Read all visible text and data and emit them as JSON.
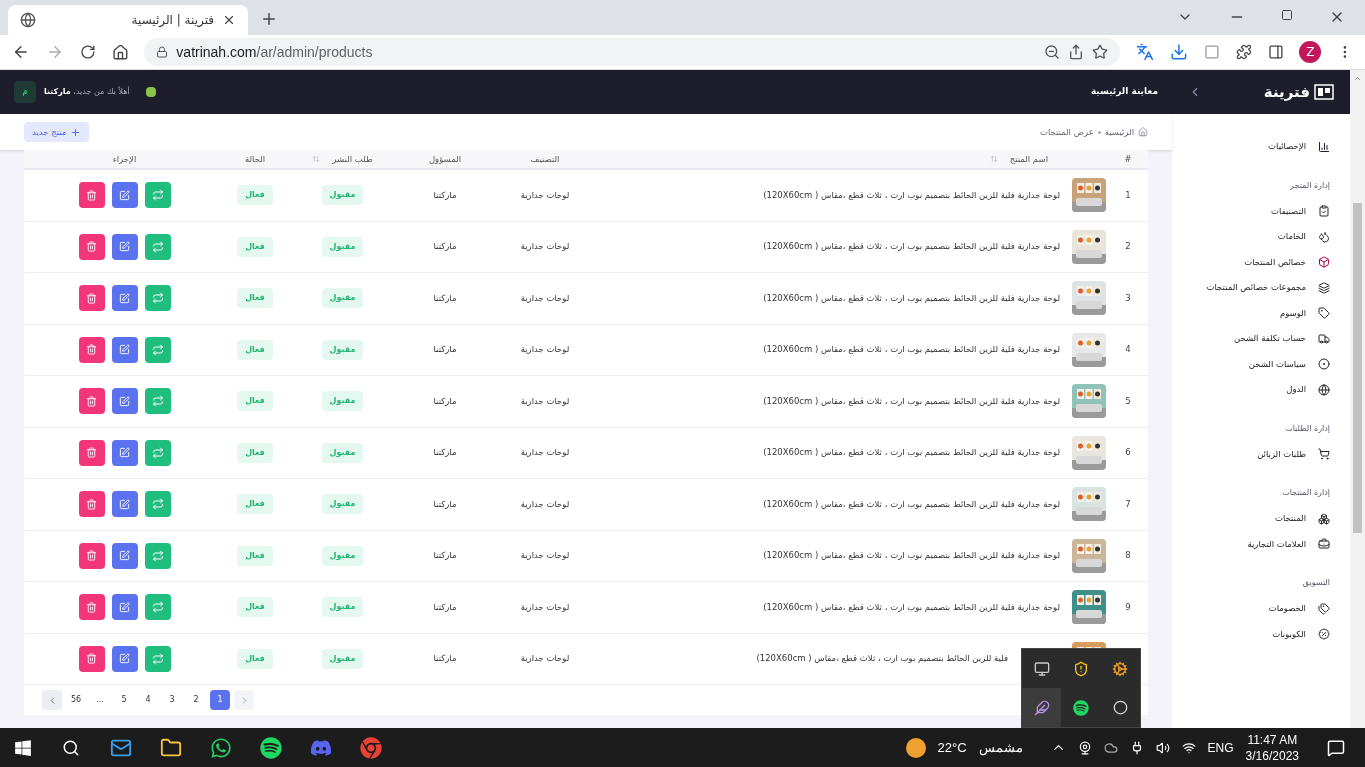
{
  "browser": {
    "tab_title": "فترينة | الرئيسية",
    "url_host": "vatrinah.com",
    "url_path": "/ar/admin/products",
    "profile": "Z"
  },
  "header": {
    "brand": "فترينة",
    "preview_link": "معاينة الرئيسية",
    "welcome": "أهلاً بك من جديد،",
    "user": "ماركتنا",
    "avatar": "م"
  },
  "sidebar": {
    "items": [
      {
        "kind": "item",
        "label": "الإحصائيات"
      },
      {
        "kind": "section",
        "label": "إدارة المتجر"
      },
      {
        "kind": "item",
        "label": "التصنيفات"
      },
      {
        "kind": "item",
        "label": "الخامات"
      },
      {
        "kind": "item",
        "label": "خصائص المنتجات"
      },
      {
        "kind": "item",
        "label": "مجموعات خصائص المنتجات"
      },
      {
        "kind": "item",
        "label": "الوسوم"
      },
      {
        "kind": "item",
        "label": "حساب تكلفة الشحن"
      },
      {
        "kind": "item",
        "label": "سياسات الشحن"
      },
      {
        "kind": "item",
        "label": "الدول"
      },
      {
        "kind": "section",
        "label": "إدارة الطلبات"
      },
      {
        "kind": "item",
        "label": "طلبات الزبائن"
      },
      {
        "kind": "section",
        "label": "إدارة المنتجات"
      },
      {
        "kind": "item",
        "label": "المنتجات"
      },
      {
        "kind": "item",
        "label": "العلامات التجارية"
      },
      {
        "kind": "section",
        "label": "التسويق"
      },
      {
        "kind": "item",
        "label": "الخصومات"
      },
      {
        "kind": "item",
        "label": "الكوبونات"
      }
    ]
  },
  "breadcrumb": [
    "الرئيسية",
    "عرض المنتجات"
  ],
  "new_button": "منتج جديد",
  "table": {
    "columns": [
      "#",
      "اسم المنتج",
      "التصنيف",
      "المسؤول",
      "طلب النشر",
      "الحالة",
      "الإجراء"
    ],
    "rows": [
      {
        "index": "1",
        "name": "لوحة جدارية فلية للزين الحائط بتصميم بوب ارت ، ثلاث قطع ،مقاس ( 120X60cm)",
        "category": "لوحات جدارية",
        "owner": "ماركتنا",
        "publish": "مقبول",
        "status": "فعال"
      },
      {
        "index": "2",
        "name": "لوحة جدارية فلية للزين الحائط بتصميم بوب ارت ، ثلاث قطع ،مقاس ( 120X60cm)",
        "category": "لوحات جدارية",
        "owner": "ماركتنا",
        "publish": "مقبول",
        "status": "فعال"
      },
      {
        "index": "3",
        "name": "لوحة جدارية فلية للزين الحائط بتصميم بوب ارت ، ثلاث قطع ،مقاس ( 120X60cm)",
        "category": "لوحات جدارية",
        "owner": "ماركتنا",
        "publish": "مقبول",
        "status": "فعال"
      },
      {
        "index": "4",
        "name": "لوحة جدارية فلية للزين الحائط بتصميم بوب ارت ، ثلاث قطع ،مقاس ( 120X60cm)",
        "category": "لوحات جدارية",
        "owner": "ماركتنا",
        "publish": "مقبول",
        "status": "فعال"
      },
      {
        "index": "5",
        "name": "لوحة جدارية فلية للزين الحائط بتصميم بوب ارت ، ثلاث قطع ،مقاس ( 120X60cm)",
        "category": "لوحات جدارية",
        "owner": "ماركتنا",
        "publish": "مقبول",
        "status": "فعال"
      },
      {
        "index": "6",
        "name": "لوحة جدارية فلية للزين الحائط بتصميم بوب ارت ، ثلاث قطع ،مقاس ( 120X60cm)",
        "category": "لوحات جدارية",
        "owner": "ماركتنا",
        "publish": "مقبول",
        "status": "فعال"
      },
      {
        "index": "7",
        "name": "لوحة جدارية فلية للزين الحائط بتصميم بوب ارت ، ثلاث قطع ،مقاس ( 120X60cm)",
        "category": "لوحات جدارية",
        "owner": "ماركتنا",
        "publish": "مقبول",
        "status": "فعال"
      },
      {
        "index": "8",
        "name": "لوحة جدارية فلية للزين الحائط بتصميم بوب ارت ، ثلاث قطع ،مقاس ( 120X60cm)",
        "category": "لوحات جدارية",
        "owner": "ماركتنا",
        "publish": "مقبول",
        "status": "فعال"
      },
      {
        "index": "9",
        "name": "لوحة جدارية فلية للزين الحائط بتصميم بوب ارت ، ثلاث قطع ،مقاس ( 120X60cm)",
        "category": "لوحات جدارية",
        "owner": "ماركتنا",
        "publish": "مقبول",
        "status": "فعال"
      },
      {
        "name": "فلية للزين الحائط بتصميم بوب ارت ، ثلاث قطع ،مقاس ( 120X60cm)",
        "category": "لوحات جدارية",
        "owner": "ماركتنا",
        "publish": "مقبول",
        "status": "فعال"
      }
    ]
  },
  "pagination": [
    {
      "label": "1",
      "selected": true
    },
    {
      "label": "2",
      "selected": false
    },
    {
      "label": "3",
      "selected": false
    },
    {
      "label": "4",
      "selected": false
    },
    {
      "label": "5",
      "selected": false
    },
    {
      "label": "...",
      "selected": false
    },
    {
      "label": "56",
      "selected": false
    }
  ],
  "taskbar": {
    "weather_temp": "22°C",
    "weather_text": "مشمس",
    "language": "ENG",
    "time": "11:47 AM",
    "date": "3/16/2023"
  }
}
